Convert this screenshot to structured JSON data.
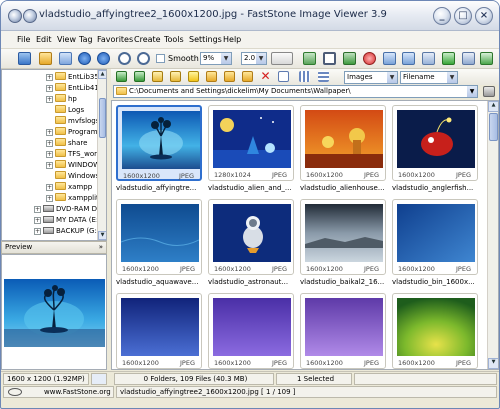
{
  "window": {
    "title": "vladstudio_affyingtree2_1600x1200.jpg - FastStone Image Viewer 3.9",
    "buttons": [
      "_",
      "□",
      "×"
    ]
  },
  "menu": [
    "File",
    "Edit",
    "View",
    "Tag",
    "Favorites",
    "Create",
    "Tools",
    "Settings",
    "Help"
  ],
  "toolbar": {
    "smooth_label": "Smooth",
    "zoom_value": "9%",
    "ratio_value": "2.0"
  },
  "toolbar2": {
    "filter_value": "Images",
    "sort_value": "Filename"
  },
  "path": "C:\\Documents and Settings\\dickelim\\My Documents\\Wallpaper\\",
  "tree": [
    {
      "label": "EntLib35",
      "type": "folder",
      "expand": "+"
    },
    {
      "label": "EntLib41",
      "type": "folder",
      "expand": "+"
    },
    {
      "label": "hp",
      "type": "folder",
      "expand": "+"
    },
    {
      "label": "Logs",
      "type": "folder",
      "expand": ""
    },
    {
      "label": "mvfslogs",
      "type": "folder",
      "expand": ""
    },
    {
      "label": "Program",
      "type": "folder",
      "expand": "+"
    },
    {
      "label": "share",
      "type": "folder",
      "expand": "+"
    },
    {
      "label": "TFS_wor",
      "type": "folder",
      "expand": "+"
    },
    {
      "label": "WINDOW",
      "type": "folder",
      "expand": "+"
    },
    {
      "label": "Windows",
      "type": "folder",
      "expand": ""
    },
    {
      "label": "xampp",
      "type": "folder",
      "expand": "+"
    },
    {
      "label": "xampplit",
      "type": "folder",
      "expand": "+"
    },
    {
      "label": "DVD-RAM Dri",
      "type": "drive",
      "expand": "+"
    },
    {
      "label": "MY DATA (E:",
      "type": "drive",
      "expand": "+"
    },
    {
      "label": "BACKUP (G:)",
      "type": "drive",
      "expand": "+"
    }
  ],
  "preview": {
    "label": "Preview",
    "chevron": "»"
  },
  "thumbnails": [
    {
      "name": "vladstudio_affyingtre...",
      "res": "1600x1200",
      "fmt": "JPEG",
      "selected": true
    },
    {
      "name": "vladstudio_alien_and_...",
      "res": "1280x1024",
      "fmt": "JPEG",
      "selected": false
    },
    {
      "name": "vladstudio_alienhouse...",
      "res": "1600x1200",
      "fmt": "JPEG",
      "selected": false
    },
    {
      "name": "vladstudio_anglerfish...",
      "res": "1600x1200",
      "fmt": "JPEG",
      "selected": false
    },
    {
      "name": "vladstudio_aquawave...",
      "res": "1600x1200",
      "fmt": "JPEG",
      "selected": false
    },
    {
      "name": "vladstudio_astronaut...",
      "res": "1600x1200",
      "fmt": "JPEG",
      "selected": false
    },
    {
      "name": "vladstudio_baikal2_16...",
      "res": "1600x1200",
      "fmt": "JPEG",
      "selected": false
    },
    {
      "name": "vladstudio_bin_1600x...",
      "res": "1600x1200",
      "fmt": "JPEG",
      "selected": false
    },
    {
      "name": "",
      "res": "1600x1200",
      "fmt": "JPEG",
      "selected": false
    },
    {
      "name": "",
      "res": "1600x1200",
      "fmt": "JPEG",
      "selected": false
    },
    {
      "name": "",
      "res": "1600x1200",
      "fmt": "JPEG",
      "selected": false
    },
    {
      "name": "",
      "res": "1600x1200",
      "fmt": "JPEG",
      "selected": false
    }
  ],
  "status": {
    "dimensions": "1600 x 1200 (1.92MP)",
    "folders_files": "0 Folders, 109 Files (40.3 MB)",
    "selected": "1 Selected"
  },
  "bottom": {
    "website": "www.FastStone.org",
    "file_info": "vladstudio_affyingtree2_1600x1200.jpg [ 1 / 109 ]"
  }
}
